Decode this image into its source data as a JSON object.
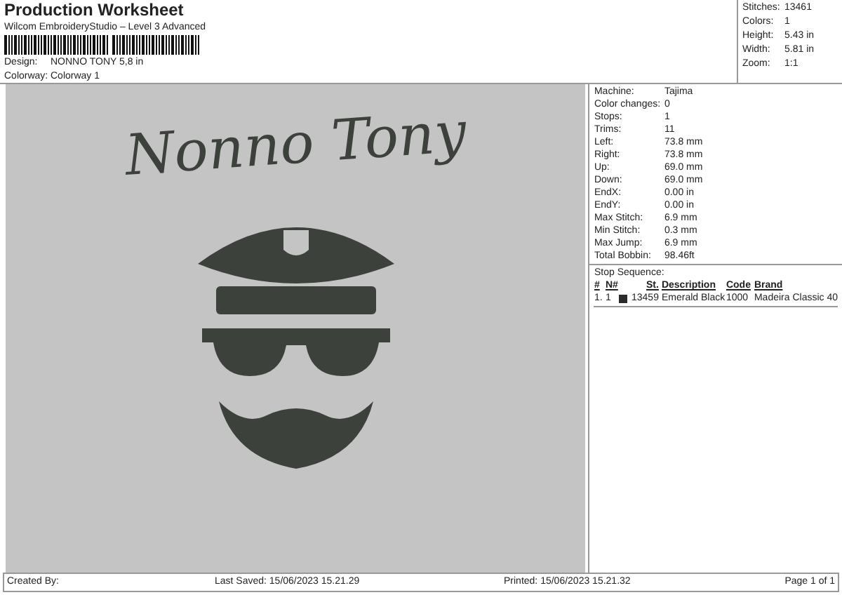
{
  "header": {
    "title": "Production Worksheet",
    "subtitle": "Wilcom EmbroideryStudio – Level 3 Advanced",
    "fields": [
      {
        "label": "Design:",
        "value": "NONNO TONY 5,8 in"
      },
      {
        "label": "Colorway:",
        "value": "Colorway 1"
      }
    ]
  },
  "summary": [
    {
      "label": "Stitches:",
      "value": "13461"
    },
    {
      "label": "Colors:",
      "value": "1"
    },
    {
      "label": "Height:",
      "value": "5.43 in"
    },
    {
      "label": "Width:",
      "value": "5.81 in"
    },
    {
      "label": "Zoom:",
      "value": "1:1"
    }
  ],
  "design": {
    "lettering": "Nonno Tony"
  },
  "details": [
    {
      "label": "Machine:",
      "value": "Tajima"
    },
    {
      "label": "Color changes:",
      "value": "0"
    },
    {
      "label": "Stops:",
      "value": "1"
    },
    {
      "label": "Trims:",
      "value": "11"
    },
    {
      "label": "Left:",
      "value": "73.8 mm"
    },
    {
      "label": "Right:",
      "value": "73.8 mm"
    },
    {
      "label": "Up:",
      "value": "69.0 mm"
    },
    {
      "label": "Down:",
      "value": "69.0 mm"
    },
    {
      "label": "EndX:",
      "value": "0.00 in"
    },
    {
      "label": "EndY:",
      "value": "0.00 in"
    },
    {
      "label": "Max Stitch:",
      "value": "6.9 mm"
    },
    {
      "label": "Min Stitch:",
      "value": "0.3 mm"
    },
    {
      "label": "Max Jump:",
      "value": "6.9 mm"
    },
    {
      "label": "Total Bobbin:",
      "value": "98.46ft"
    }
  ],
  "stop_sequence": {
    "title": "Stop Sequence:",
    "columns": [
      "#",
      "N#",
      "St.",
      "Description",
      "Code",
      "Brand"
    ],
    "rows": [
      {
        "index": "1.",
        "needle": "1",
        "color": "#2b2b2b",
        "stitches": "13459",
        "description": "Emerald Black",
        "code": "1000",
        "brand": "Madeira Classic 40"
      }
    ]
  },
  "footer": {
    "created": "Created By:",
    "saved": "Last Saved: 15/06/2023 15.21.29",
    "printed": "Printed: 15/06/2023 15.21.32",
    "page": "Page 1 of 1"
  }
}
